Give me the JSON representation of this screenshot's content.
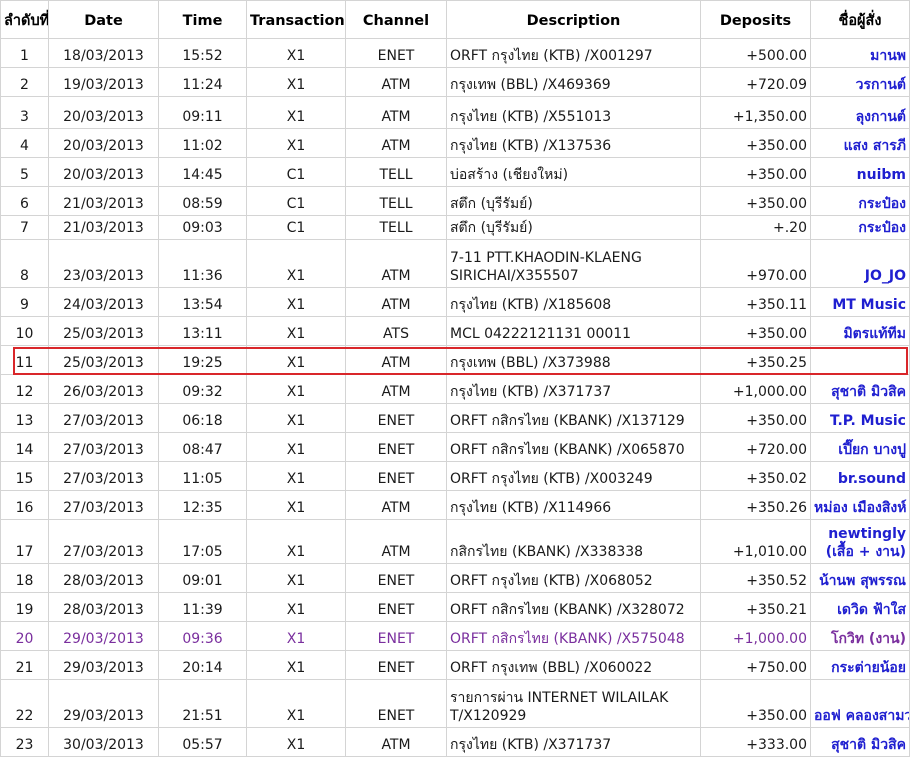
{
  "colors": {
    "name_blue": "#1f1fd0",
    "pending_purple": "#7a2f9e",
    "highlight_red": "#d9262a",
    "grid": "#d4d4d4"
  },
  "headers": [
    "ลำดับที่",
    "Date",
    "Time",
    "Transaction",
    "Channel",
    "Description",
    "Deposits",
    "ชื่อผู้สั่ง"
  ],
  "rows": [
    {
      "no": "1",
      "date": "18/03/2013",
      "time": "15:52",
      "tr": "X1",
      "ch": "ENET",
      "desc": "ORFT กรุงไทย (KTB) /X001297",
      "dep": "+500.00",
      "name": "มานพ"
    },
    {
      "no": "2",
      "date": "19/03/2013",
      "time": "11:24",
      "tr": "X1",
      "ch": "ATM",
      "desc": "กรุงเทพ (BBL) /X469369",
      "dep": "+720.09",
      "name": "วรกานต์"
    },
    {
      "no": "3",
      "date": "20/03/2013",
      "time": "09:11",
      "tr": "X1",
      "ch": "ATM",
      "desc": "กรุงไทย (KTB) /X551013",
      "dep": "+1,350.00",
      "name": "ลุงกานต์"
    },
    {
      "no": "4",
      "date": "20/03/2013",
      "time": "11:02",
      "tr": "X1",
      "ch": "ATM",
      "desc": "กรุงไทย (KTB) /X137536",
      "dep": "+350.00",
      "name": "แสง สารภี"
    },
    {
      "no": "5",
      "date": "20/03/2013",
      "time": "14:45",
      "tr": "C1",
      "ch": "TELL",
      "desc": "บ่อสร้าง (เชียงใหม่)",
      "dep": "+350.00",
      "name": "nuibm"
    },
    {
      "no": "6",
      "date": "21/03/2013",
      "time": "08:59",
      "tr": "C1",
      "ch": "TELL",
      "desc": "สตึก (บุรีรัมย์)",
      "dep": "+350.00",
      "name": "กระป๋อง"
    },
    {
      "no": "7",
      "date": "21/03/2013",
      "time": "09:03",
      "tr": "C1",
      "ch": "TELL",
      "desc": "สตึก (บุรีรัมย์)",
      "dep": "+.20",
      "name": "กระป๋อง"
    },
    {
      "no": "8",
      "date": "23/03/2013",
      "time": "11:36",
      "tr": "X1",
      "ch": "ATM",
      "desc": "7-11 PTT.KHAODIN-KLAENG SIRICHAI/X355507",
      "dep": "+970.00",
      "name": "JO_JO"
    },
    {
      "no": "9",
      "date": "24/03/2013",
      "time": "13:54",
      "tr": "X1",
      "ch": "ATM",
      "desc": "กรุงไทย (KTB) /X185608",
      "dep": "+350.11",
      "name": "MT Music"
    },
    {
      "no": "10",
      "date": "25/03/2013",
      "time": "13:11",
      "tr": "X1",
      "ch": "ATS",
      "desc": "MCL 04222121131 00011",
      "dep": "+350.00",
      "name": "มิตรแท้ทีม"
    },
    {
      "no": "11",
      "date": "25/03/2013",
      "time": "19:25",
      "tr": "X1",
      "ch": "ATM",
      "desc": "กรุงเทพ (BBL) /X373988",
      "dep": "+350.25",
      "name": ""
    },
    {
      "no": "12",
      "date": "26/03/2013",
      "time": "09:32",
      "tr": "X1",
      "ch": "ATM",
      "desc": "กรุงไทย (KTB) /X371737",
      "dep": "+1,000.00",
      "name": "สุชาติ มิวสิค"
    },
    {
      "no": "13",
      "date": "27/03/2013",
      "time": "06:18",
      "tr": "X1",
      "ch": "ENET",
      "desc": "ORFT กสิกรไทย (KBANK) /X137129",
      "dep": "+350.00",
      "name": "T.P. Music"
    },
    {
      "no": "14",
      "date": "27/03/2013",
      "time": "08:47",
      "tr": "X1",
      "ch": "ENET",
      "desc": "ORFT กสิกรไทย (KBANK) /X065870",
      "dep": "+720.00",
      "name": "เปี๊ยก บางปู"
    },
    {
      "no": "15",
      "date": "27/03/2013",
      "time": "11:05",
      "tr": "X1",
      "ch": "ENET",
      "desc": "ORFT กรุงไทย (KTB) /X003249",
      "dep": "+350.02",
      "name": "br.sound"
    },
    {
      "no": "16",
      "date": "27/03/2013",
      "time": "12:35",
      "tr": "X1",
      "ch": "ATM",
      "desc": "กรุงไทย (KTB) /X114966",
      "dep": "+350.26",
      "name": "หม่อง เมืองสิงห์"
    },
    {
      "no": "17",
      "date": "27/03/2013",
      "time": "17:05",
      "tr": "X1",
      "ch": "ATM",
      "desc": "กสิกรไทย (KBANK) /X338338",
      "dep": "+1,010.00",
      "name": "newtingly (เสื้อ + งาน)"
    },
    {
      "no": "18",
      "date": "28/03/2013",
      "time": "09:01",
      "tr": "X1",
      "ch": "ENET",
      "desc": "ORFT กรุงไทย (KTB) /X068052",
      "dep": "+350.52",
      "name": "น้านพ สุพรรณ"
    },
    {
      "no": "19",
      "date": "28/03/2013",
      "time": "11:39",
      "tr": "X1",
      "ch": "ENET",
      "desc": "ORFT กสิกรไทย (KBANK) /X328072",
      "dep": "+350.21",
      "name": "เดวิด ฟ้าใส"
    },
    {
      "no": "20",
      "date": "29/03/2013",
      "time": "09:36",
      "tr": "X1",
      "ch": "ENET",
      "desc": "ORFT กสิกรไทย (KBANK) /X575048",
      "dep": "+1,000.00",
      "name": "โกวิท (งาน)"
    },
    {
      "no": "21",
      "date": "29/03/2013",
      "time": "20:14",
      "tr": "X1",
      "ch": "ENET",
      "desc": "ORFT กรุงเทพ (BBL) /X060022",
      "dep": "+750.00",
      "name": "กระต่ายน้อย"
    },
    {
      "no": "22",
      "date": "29/03/2013",
      "time": "21:51",
      "tr": "X1",
      "ch": "ENET",
      "desc": "รายการผ่าน INTERNET WILAILAK T/X120929",
      "dep": "+350.00",
      "name": "ออฟ คลองสามวา"
    },
    {
      "no": "23",
      "date": "30/03/2013",
      "time": "05:57",
      "tr": "X1",
      "ch": "ATM",
      "desc": "กรุงไทย (KTB) /X371737",
      "dep": "+333.00",
      "name": "สุชาติ มิวสิค"
    }
  ]
}
